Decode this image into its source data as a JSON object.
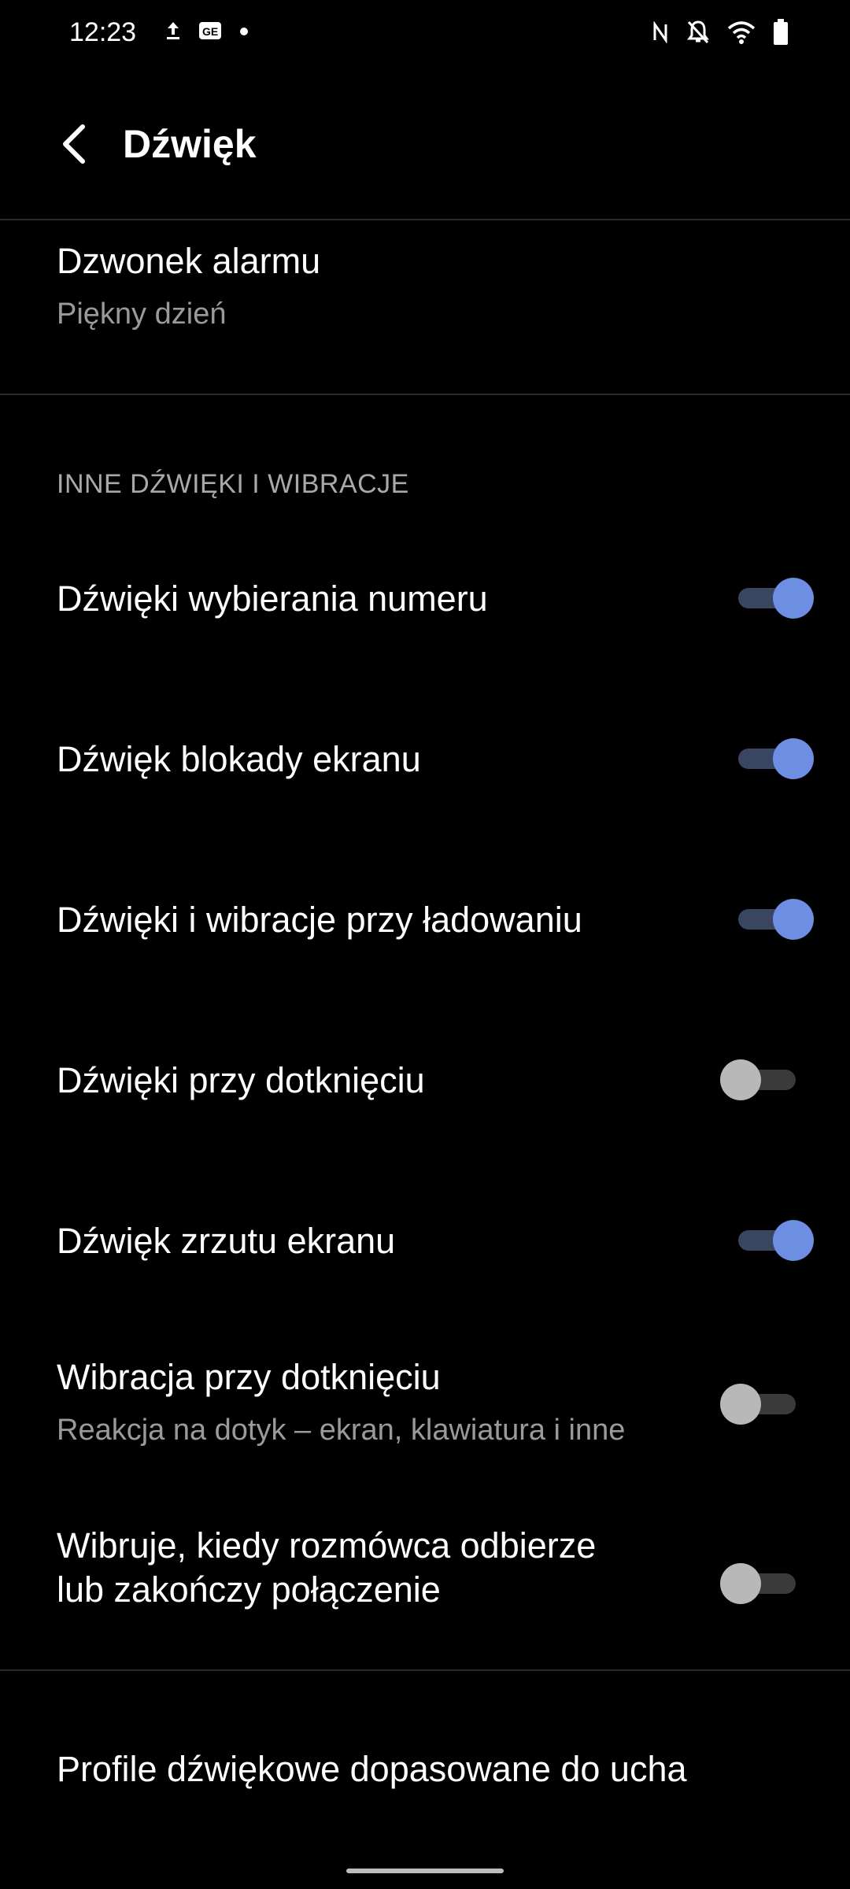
{
  "status_bar": {
    "time": "12:23",
    "left_icons": [
      "upload-icon",
      "gallery-icon",
      "dot-icon"
    ],
    "right_icons": [
      "nfc-icon",
      "bell-off-icon",
      "wifi-icon",
      "battery-icon"
    ]
  },
  "header": {
    "title": "Dźwięk",
    "back_icon": "back-arrow-icon"
  },
  "alarm_ringtone": {
    "title": "Dzwonek alarmu",
    "subtitle": "Piękny dzień"
  },
  "section": {
    "header": "INNE DŹWIĘKI I WIBRACJE"
  },
  "settings": [
    {
      "label": "Dźwięki wybierania numeru",
      "enabled": true
    },
    {
      "label": "Dźwięk blokady ekranu",
      "enabled": true
    },
    {
      "label": "Dźwięki i wibracje przy ładowaniu",
      "enabled": true
    },
    {
      "label": "Dźwięki przy dotknięciu",
      "enabled": false
    },
    {
      "label": "Dźwięk zrzutu ekranu",
      "enabled": true
    },
    {
      "label": "Wibracja przy dotknięciu",
      "subtitle": "Reakcja na dotyk – ekran, klawiatura i inne",
      "enabled": false
    },
    {
      "label_line1": "Wibruje, kiedy rozmówca odbierze",
      "label_line2": "lub zakończy połączenie",
      "enabled": false
    }
  ],
  "profiles": {
    "label": "Profile dźwiękowe dopasowane do ucha"
  },
  "colors": {
    "accent": "#6d8ee2",
    "track_on": "#3a4661",
    "thumb_off": "#b8b8b8",
    "background": "#000000"
  }
}
